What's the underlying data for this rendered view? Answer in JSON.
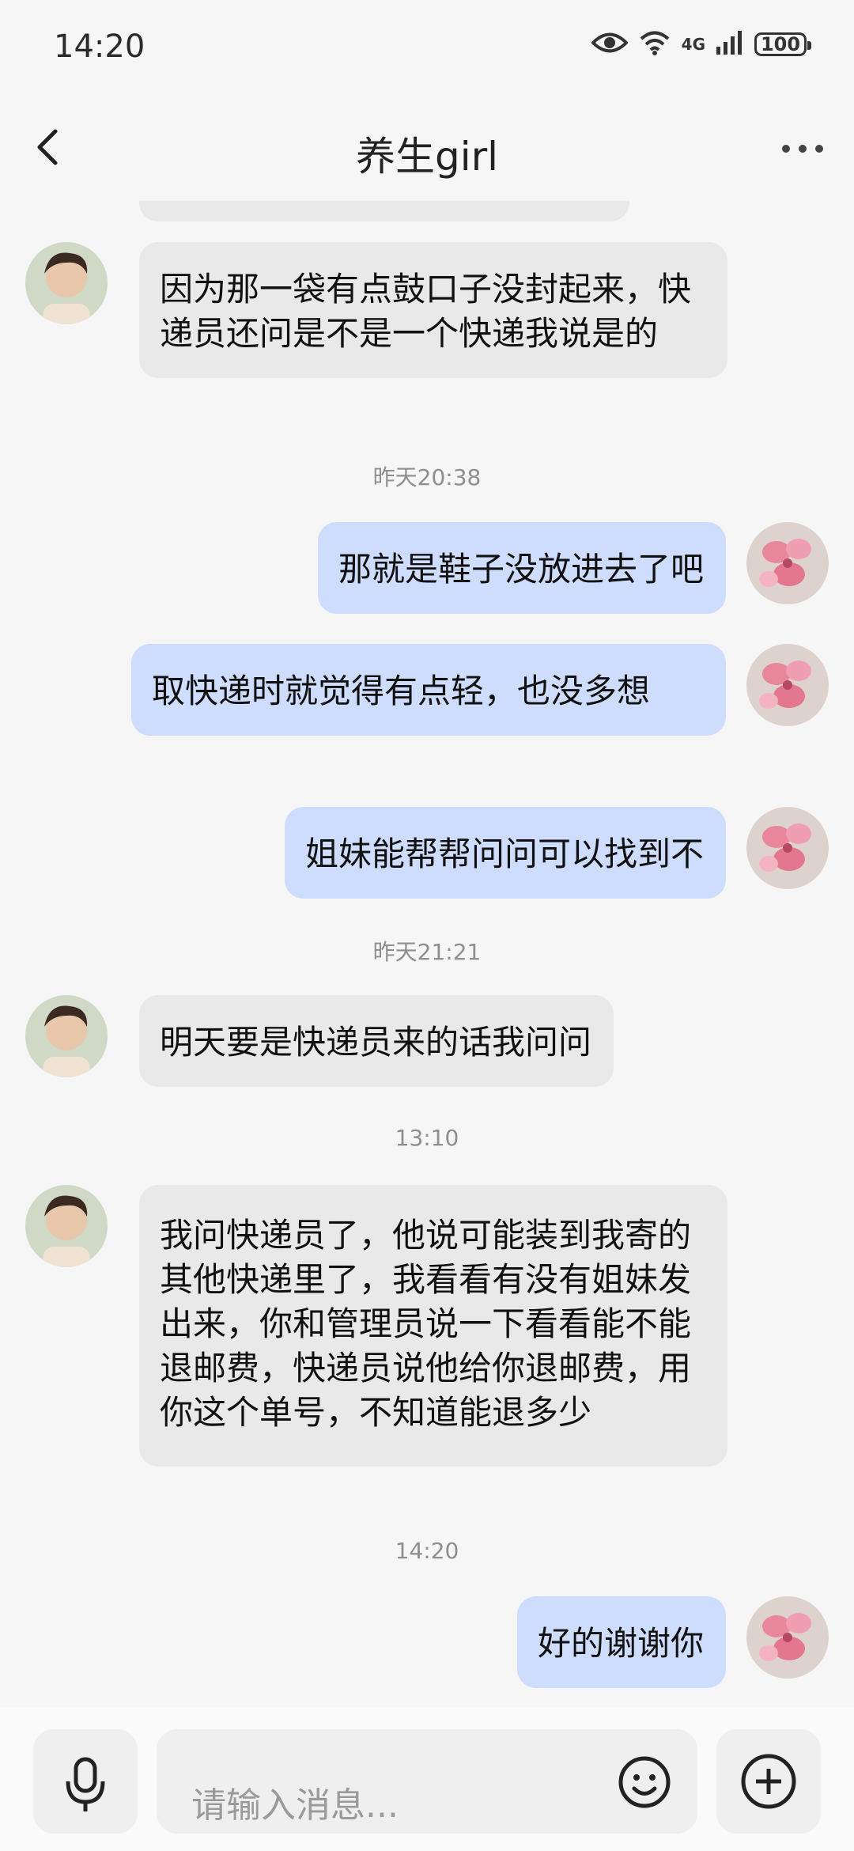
{
  "status_bar": {
    "time": "14:20",
    "network": "4G",
    "battery": "100",
    "icons": [
      "eye-icon",
      "wifi-icon",
      "signal-icon",
      "battery-icon"
    ]
  },
  "header": {
    "title": "养生girl",
    "back_icon": "chevron-left-icon",
    "more_icon": "more-dots-icon"
  },
  "messages": [
    {
      "side": "in",
      "text": "因为那一袋有点鼓口子没封起来，快递员还问是不是一个快递我说是的"
    },
    {
      "timestamp": "昨天20:38"
    },
    {
      "side": "out",
      "text": "那就是鞋子没放进去了吧"
    },
    {
      "side": "out",
      "text": "取快递时就觉得有点轻，也没多想"
    },
    {
      "side": "out",
      "text": "姐妹能帮帮问问可以找到不"
    },
    {
      "timestamp": "昨天21:21"
    },
    {
      "side": "in",
      "text": "明天要是快递员来的话我问问"
    },
    {
      "timestamp": "13:10"
    },
    {
      "side": "in",
      "text": "我问快递员了，他说可能装到我寄的其他快递里了，我看看有没有姐妹发出来，你和管理员说一下看看能不能退邮费，快递员说他给你退邮费，用你这个单号，不知道能退多少"
    },
    {
      "timestamp": "14:20"
    },
    {
      "side": "out",
      "text": "好的谢谢你"
    }
  ],
  "input": {
    "placeholder": "请输入消息...",
    "voice_icon": "microphone-icon",
    "emoji_icon": "emoji-icon",
    "plus_icon": "plus-icon"
  },
  "colors": {
    "incoming_bubble": "#e9e9e9",
    "outgoing_bubble": "#cedcfd",
    "background": "#f6f6f6"
  }
}
